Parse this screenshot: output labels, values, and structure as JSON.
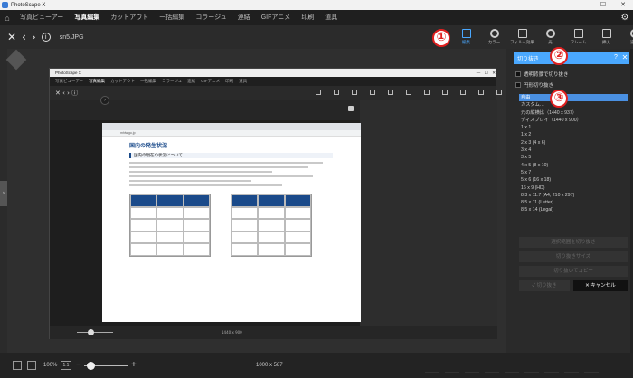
{
  "app": {
    "title": "PhotoScape X"
  },
  "tabs": [
    "写真ビューアー",
    "写真編集",
    "カットアウト",
    "一括編集",
    "コラージュ",
    "連結",
    "GIFアニメ",
    "印刷",
    "道具"
  ],
  "active_tab": "写真編集",
  "toolbar": {
    "filename": "sn5.JPG",
    "tools": [
      {
        "label": "編集",
        "icon": "edit-icon",
        "active": true
      },
      {
        "label": "カラー",
        "icon": "color-icon"
      },
      {
        "label": "フィルム効果",
        "icon": "film-icon"
      },
      {
        "label": "光",
        "icon": "light-icon"
      },
      {
        "label": "フレーム",
        "icon": "frame-icon"
      },
      {
        "label": "挿入",
        "icon": "insert-icon"
      },
      {
        "label": "道具",
        "icon": "tools-icon"
      }
    ]
  },
  "badges": [
    "①",
    "②",
    "③"
  ],
  "panel": {
    "title": "切り抜き",
    "check1": "透明背景で切り抜き",
    "check2": "円形切り抜き",
    "options": [
      "自由",
      "カスタム…",
      "元の縦横比（1440 x 937）",
      "ディスプレイ（1440 x 900）",
      "1 x 1",
      "1 x 2",
      "2 x 3 (4 x 6)",
      "3 x 4",
      "3 x 5",
      "4 x 5 (8 x 10)",
      "5 x 7",
      "5 x 6 (16 x 18)",
      "16 x 9 (HD)",
      "8.3 x 11.7 (A4, 210 x 297)",
      "8.5 x 11 (Letter)",
      "8.5 x 14 (Legal)"
    ],
    "selected": "自由",
    "btn1": "選択範囲を切り抜き",
    "btn2": "切り抜きサイズ",
    "btn3": "切り抜いてコピー",
    "ok": "✓ 切り抜き",
    "cancel": "✕ キャンセル"
  },
  "inner": {
    "title": "PhotoScape X",
    "tabs": [
      "写真ビューアー",
      "写真編集",
      "カットアウト",
      "一括編集",
      "コラージュ",
      "連結",
      "GIFアニメ",
      "印刷",
      "道具"
    ],
    "url": "mhlw.go.jp",
    "heading": "国内の発生状況",
    "subheading": "国内の現在の状況について",
    "dims": "1440 x 900"
  },
  "status": {
    "zoom": "100%",
    "ratio": "1:1",
    "dims": "1000 x 587"
  }
}
